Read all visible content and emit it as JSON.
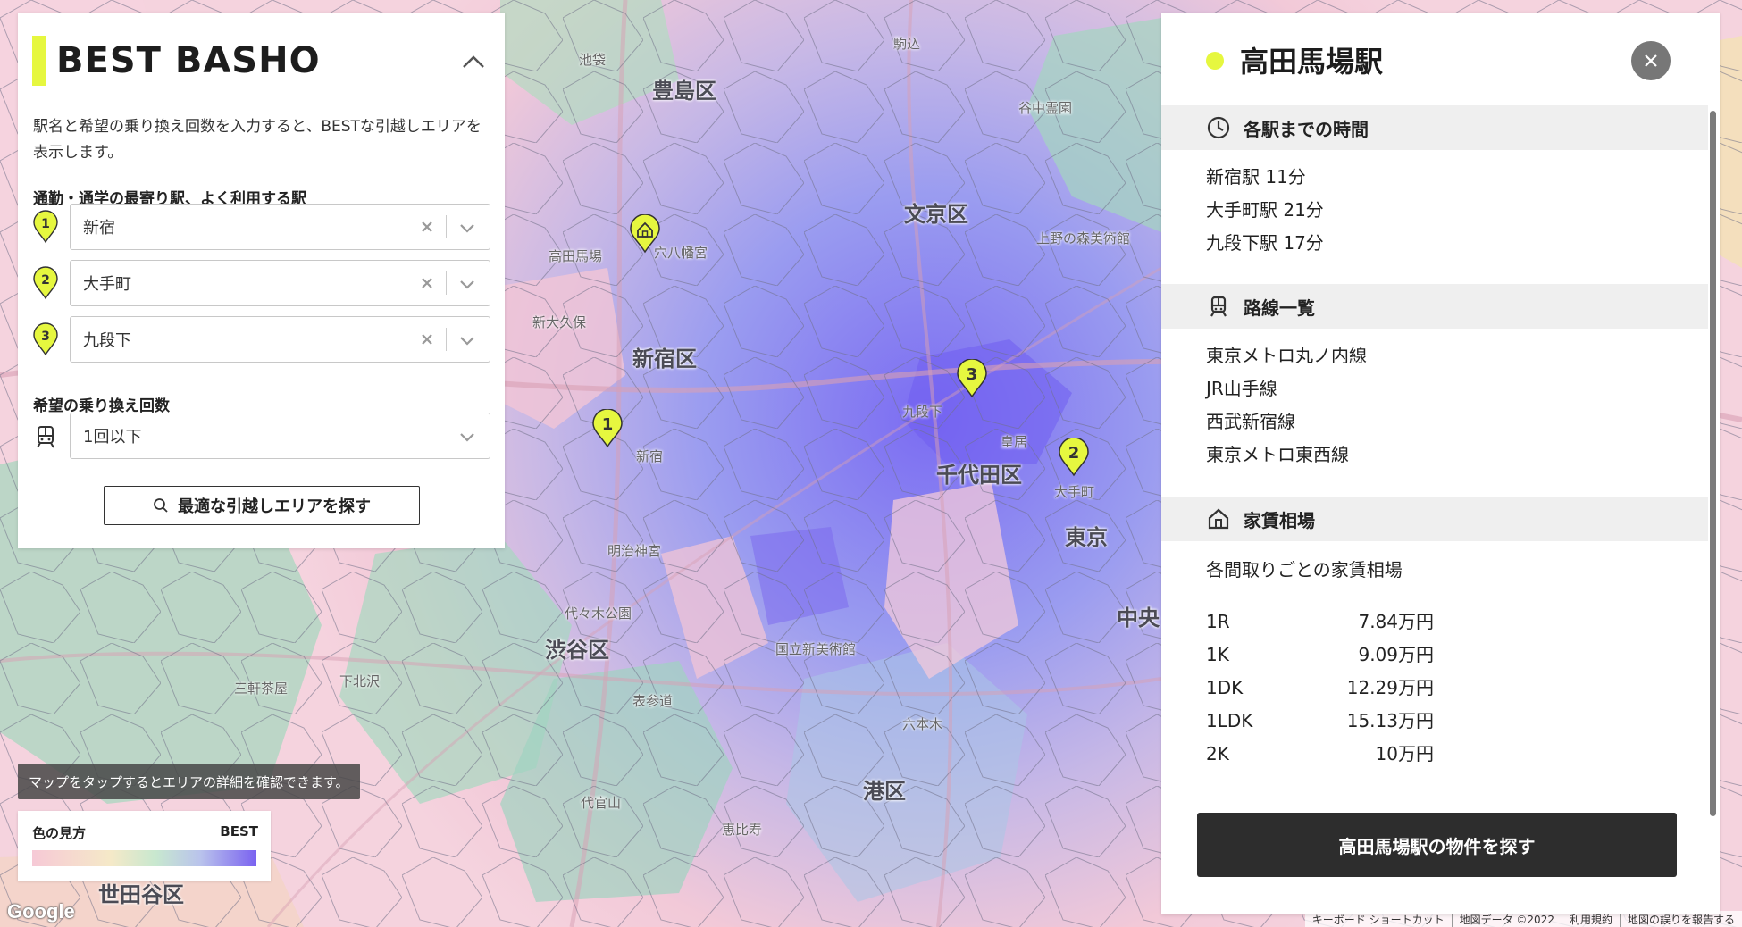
{
  "map": {
    "labels_big": [
      "豊島区",
      "文京区",
      "新宿区",
      "千代田区",
      "渋谷区",
      "港区",
      "世田谷区",
      "東京",
      "中央"
    ],
    "labels_small": [
      "駒込",
      "谷中霊園",
      "上野の森美術館",
      "穴八幡宮",
      "新宿",
      "明治神宮",
      "代々木公園",
      "表参道",
      "国立新美術館",
      "新大久保",
      "高田馬場",
      "池袋",
      "三軒茶屋",
      "恵比寿",
      "六本木",
      "皇居",
      "九段下",
      "大手町",
      "代官山",
      "下北沢"
    ],
    "pins": [
      "1",
      "2",
      "3"
    ],
    "home_pin_icon": "home-icon"
  },
  "search_panel": {
    "brand_title": "BEST BASHO",
    "description": "駅名と希望の乗り換え回数を入力すると、BESTな引越しエリアを表示します。",
    "stations_label": "通勤・通学の最寄り駅、よく利用する駅",
    "stations": [
      {
        "number": "1",
        "value": "新宿"
      },
      {
        "number": "2",
        "value": "大手町"
      },
      {
        "number": "3",
        "value": "九段下"
      }
    ],
    "transfer_label": "希望の乗り換え回数",
    "transfer_value": "1回以下",
    "search_button": "最適な引越しエリアを探す",
    "accent_color": "#e6f73f"
  },
  "tooltip": "マップをタップするとエリアの詳細を確認できます。",
  "legend": {
    "title": "色の見方",
    "best_label": "BEST"
  },
  "attribution": {
    "google": "Google",
    "items": [
      "キーボード ショートカット",
      "地図データ ©2022",
      "利用規約",
      "地図の誤りを報告する"
    ]
  },
  "detail_panel": {
    "station_name": "高田馬場駅",
    "times_section": "各駅までの時間",
    "times": [
      "新宿駅 11分",
      "大手町駅 21分",
      "九段下駅 17分"
    ],
    "lines_section": "路線一覧",
    "lines": [
      "東京メトロ丸ノ内線",
      "JR山手線",
      "西武新宿線",
      "東京メトロ東西線"
    ],
    "rent_section": "家賃相場",
    "rent_note": "各間取りごとの家賃相場",
    "rent": [
      {
        "layout": "1R",
        "price": "7.84万円"
      },
      {
        "layout": "1K",
        "price": "9.09万円"
      },
      {
        "layout": "1DK",
        "price": "12.29万円"
      },
      {
        "layout": "1LDK",
        "price": "15.13万円"
      },
      {
        "layout": "2K",
        "price": "10万円"
      }
    ],
    "cta_button": "高田馬場駅の物件を探す"
  }
}
